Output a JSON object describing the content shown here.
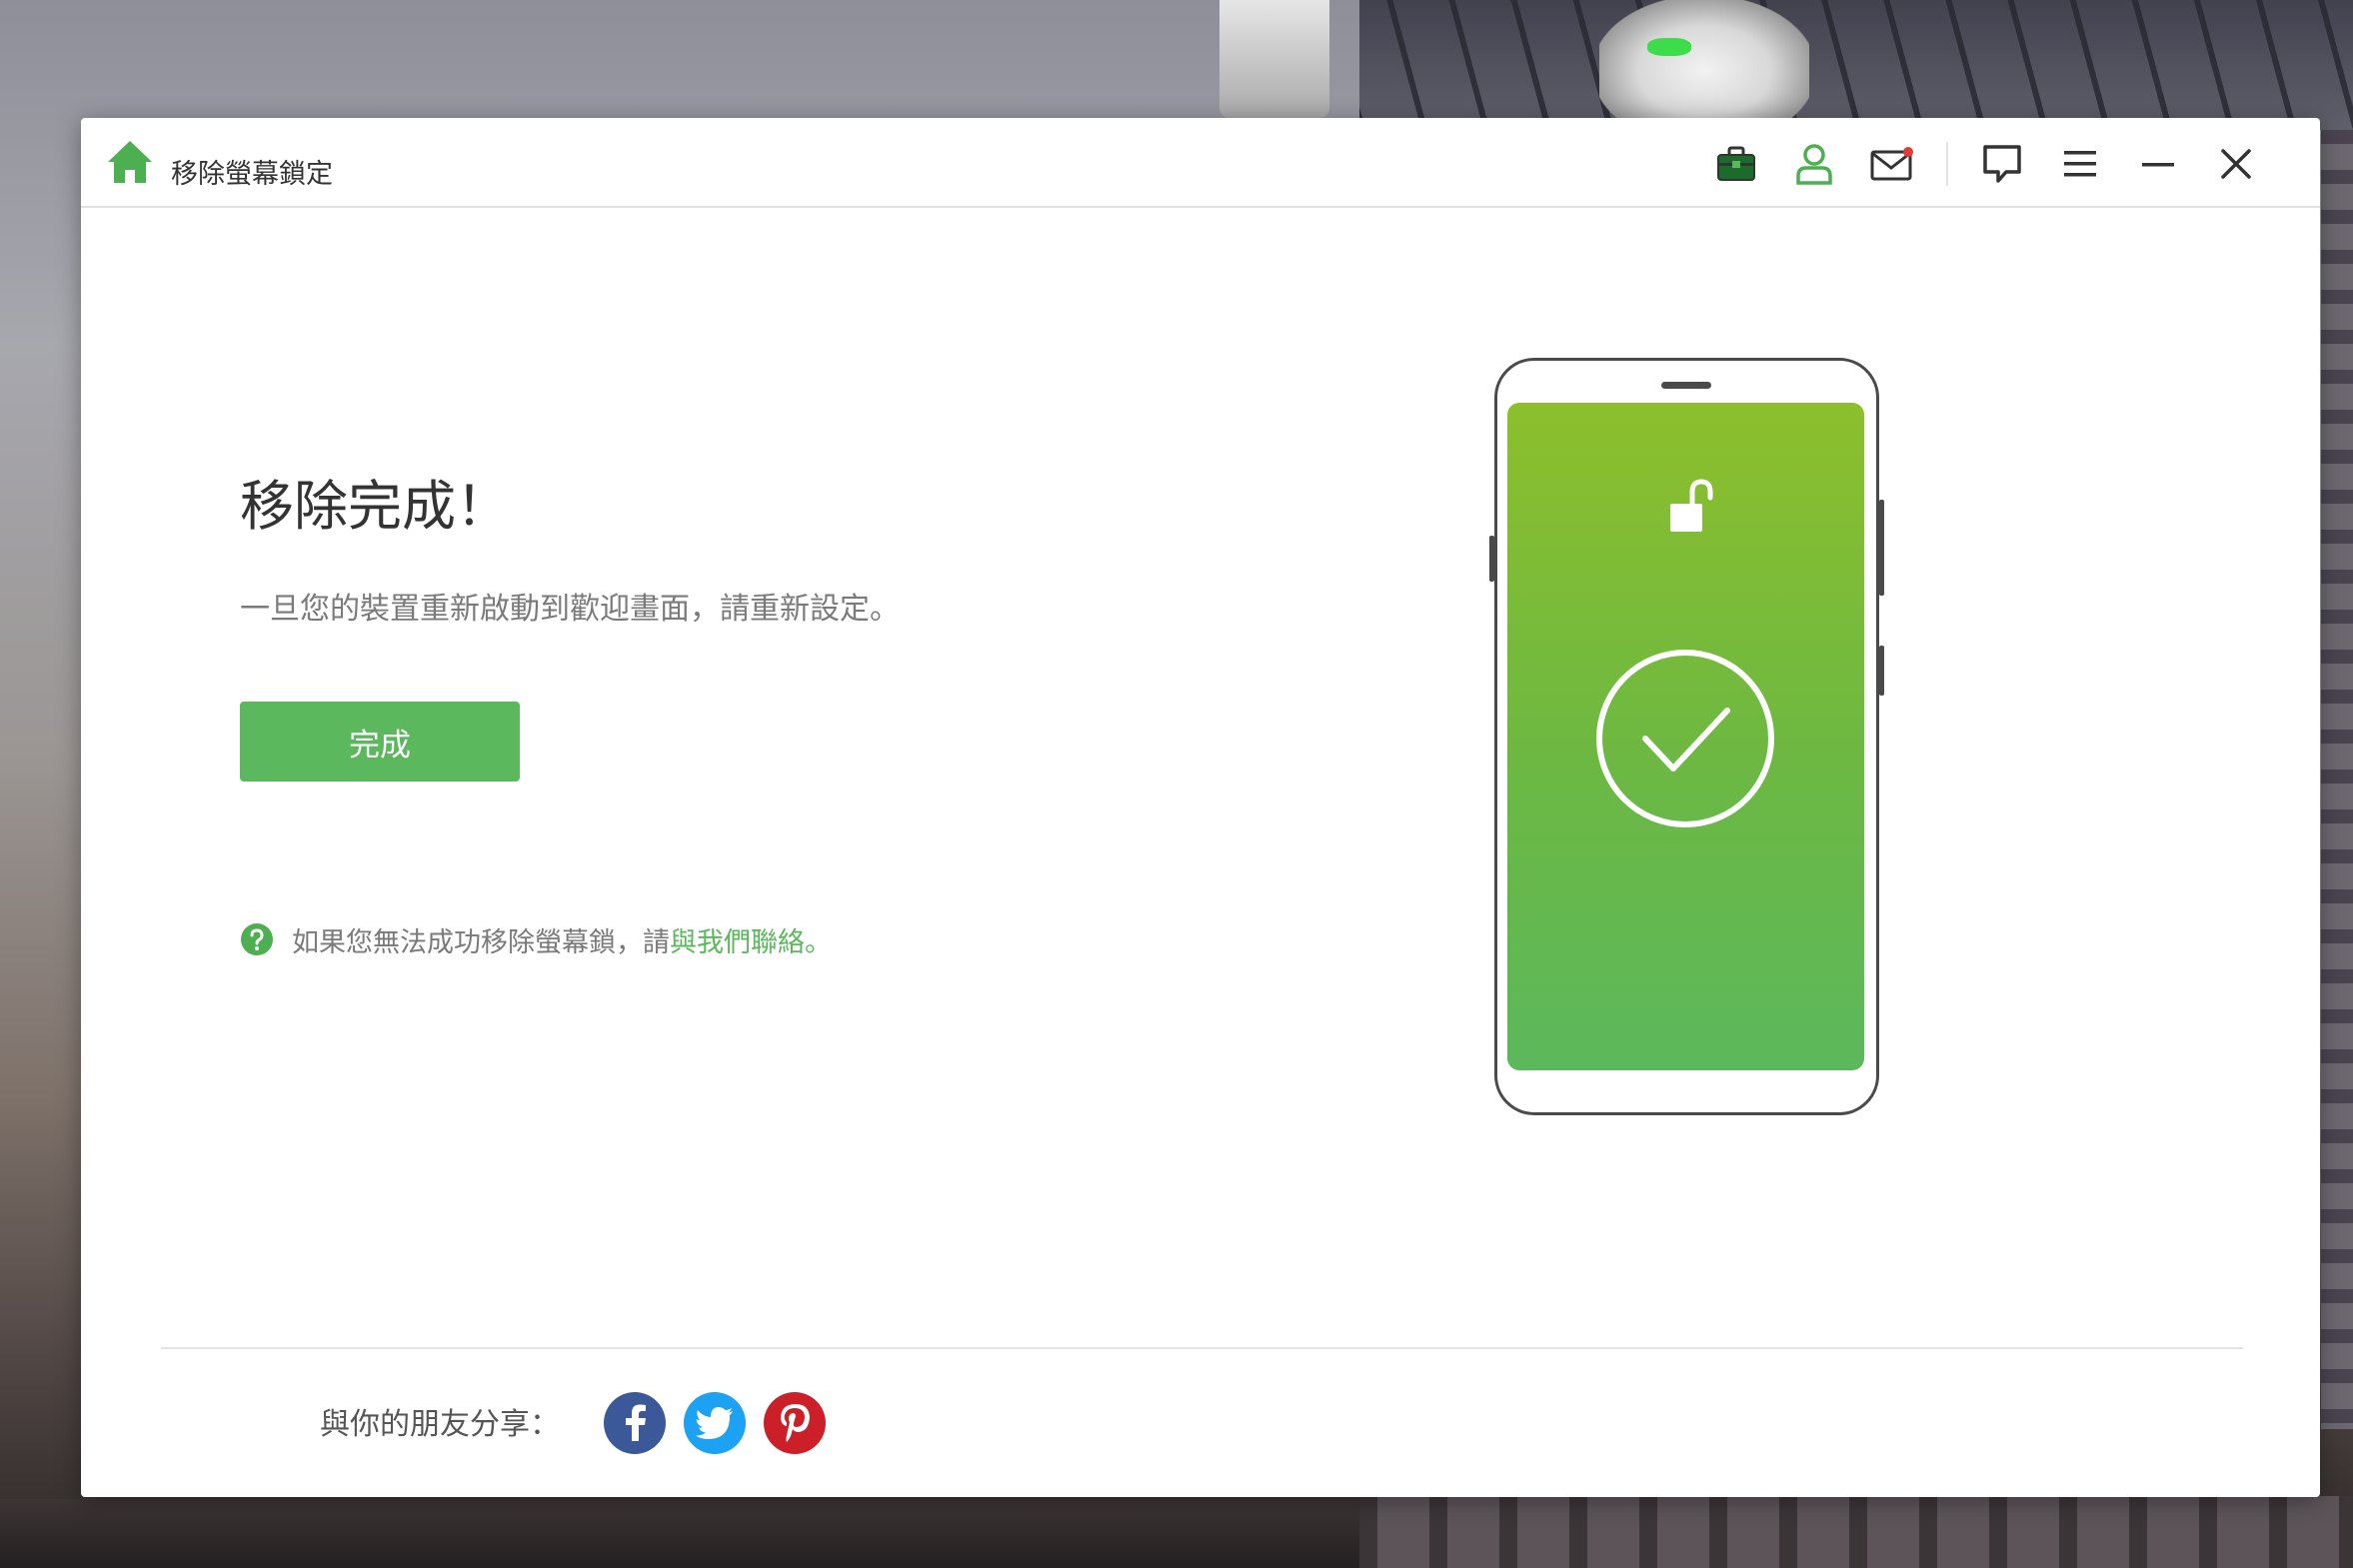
{
  "app": {
    "title": "移除螢幕鎖定"
  },
  "toolbar": {
    "icons": [
      "toolbox-icon",
      "account-icon",
      "mail-icon",
      "feedback-icon",
      "menu-icon",
      "minimize-icon",
      "close-icon"
    ]
  },
  "main": {
    "headline": "移除完成！",
    "subtext": "一旦您的裝置重新啟動到歡迎畫面，請重新設定。",
    "done_button": "完成",
    "help_text": "如果您無法成功移除螢幕鎖，請",
    "help_link": "與我們聯絡",
    "help_suffix": "。"
  },
  "share": {
    "label": "與你的朋友分享：",
    "networks": [
      "facebook",
      "twitter",
      "pinterest"
    ]
  },
  "colors": {
    "accent": "#5cb85c",
    "facebook": "#3b5998",
    "twitter": "#1da1f2",
    "pinterest": "#cb2027",
    "notification_dot": "#e53935"
  }
}
